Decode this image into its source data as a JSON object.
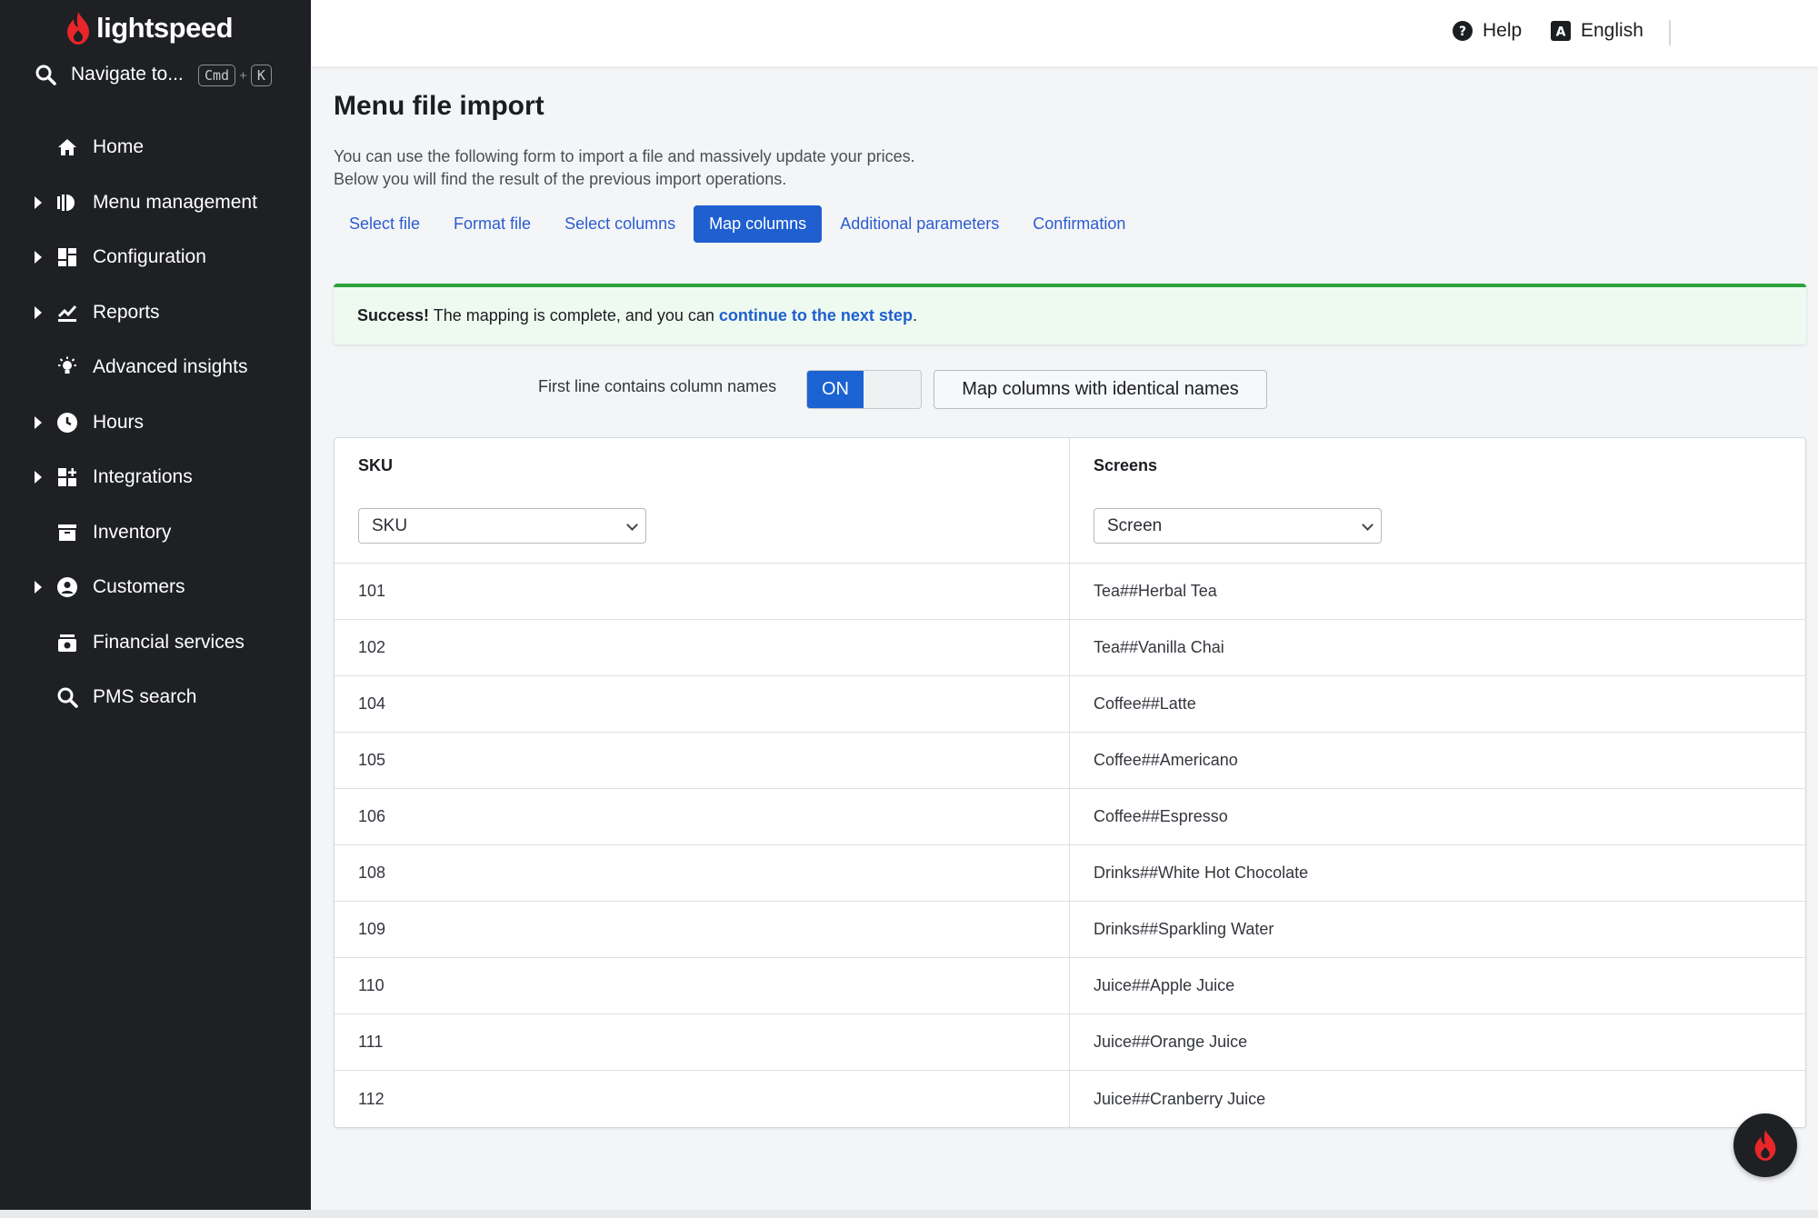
{
  "brand": {
    "name": "lightspeed",
    "accent": "#e8262a"
  },
  "sidebar": {
    "search_label": "Navigate to...",
    "shortcut": [
      "Cmd",
      "K"
    ],
    "shortcut_plus": "+",
    "items": [
      {
        "label": "Home",
        "icon": "home-icon",
        "expandable": false
      },
      {
        "label": "Menu management",
        "icon": "menu-management-icon",
        "expandable": true
      },
      {
        "label": "Configuration",
        "icon": "configuration-icon",
        "expandable": true
      },
      {
        "label": "Reports",
        "icon": "reports-icon",
        "expandable": true
      },
      {
        "label": "Advanced insights",
        "icon": "lightbulb-icon",
        "expandable": false
      },
      {
        "label": "Hours",
        "icon": "clock-icon",
        "expandable": true
      },
      {
        "label": "Integrations",
        "icon": "integrations-icon",
        "expandable": true
      },
      {
        "label": "Inventory",
        "icon": "inventory-icon",
        "expandable": false
      },
      {
        "label": "Customers",
        "icon": "customer-icon",
        "expandable": true
      },
      {
        "label": "Financial services",
        "icon": "cash-register-icon",
        "expandable": false
      },
      {
        "label": "PMS search",
        "icon": "search-icon",
        "expandable": false
      }
    ]
  },
  "topbar": {
    "help": "Help",
    "language": "English"
  },
  "page": {
    "title": "Menu file import",
    "desc_line1": "You can use the following form to import a file and massively update your prices.",
    "desc_line2": "Below you will find the result of the previous import operations.",
    "steps": [
      {
        "label": "Select file",
        "active": false
      },
      {
        "label": "Format file",
        "active": false
      },
      {
        "label": "Select columns",
        "active": false
      },
      {
        "label": "Map columns",
        "active": true
      },
      {
        "label": "Additional parameters",
        "active": false
      },
      {
        "label": "Confirmation",
        "active": false
      }
    ]
  },
  "alert": {
    "strong": "Success!",
    "text": " The mapping is complete, and you can ",
    "link": "continue to the next step",
    "end": "."
  },
  "options": {
    "first_line_label": "First line contains column names",
    "toggle_state": "ON",
    "map_button": "Map columns with identical names"
  },
  "table": {
    "columns": [
      {
        "title": "SKU",
        "selected": "SKU"
      },
      {
        "title": "Screens",
        "selected": "Screen"
      }
    ],
    "rows": [
      [
        "101",
        "Tea##Herbal Tea"
      ],
      [
        "102",
        "Tea##Vanilla Chai"
      ],
      [
        "104",
        "Coffee##Latte"
      ],
      [
        "105",
        "Coffee##Americano"
      ],
      [
        "106",
        "Coffee##Espresso"
      ],
      [
        "108",
        "Drinks##White Hot Chocolate"
      ],
      [
        "109",
        "Drinks##Sparkling Water"
      ],
      [
        "110",
        "Juice##Apple Juice"
      ],
      [
        "111",
        "Juice##Orange Juice"
      ],
      [
        "112",
        "Juice##Cranberry Juice"
      ]
    ]
  }
}
